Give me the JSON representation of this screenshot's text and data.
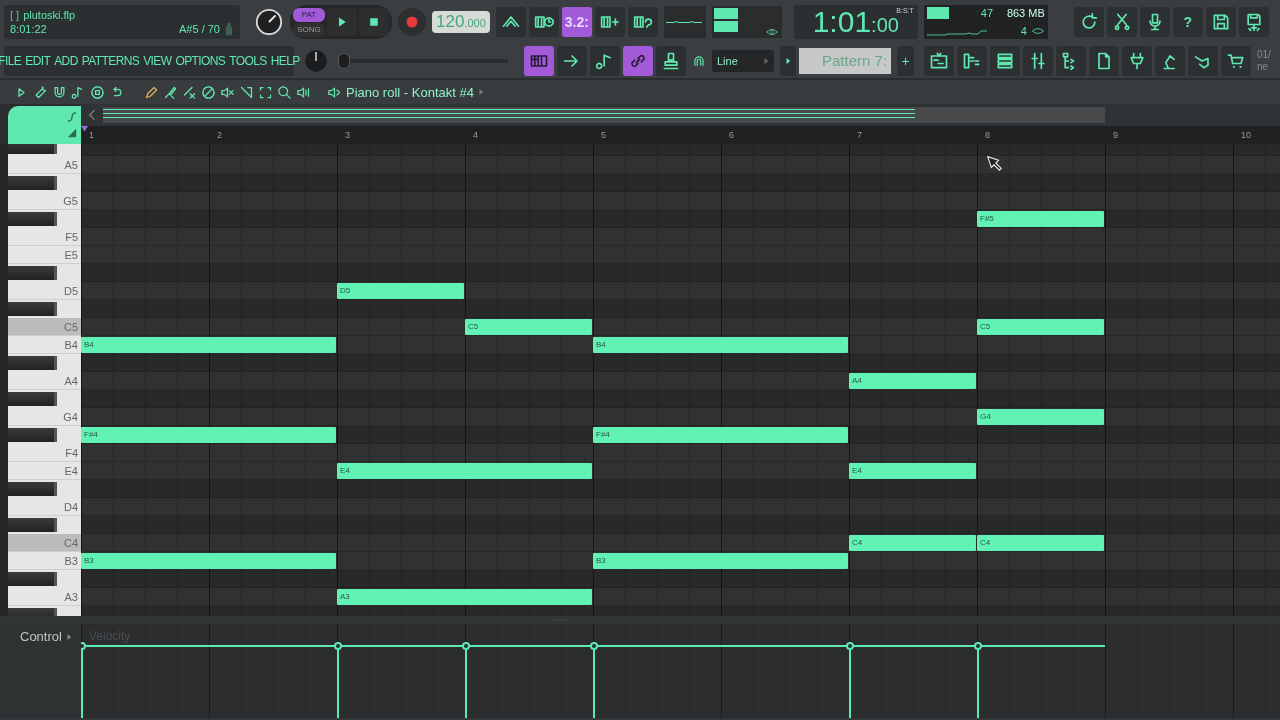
{
  "file_panel": {
    "brackets": "[ ]",
    "file_name": "plutoski.flp",
    "time": "8:01:22",
    "hint": "A#5 / 70"
  },
  "modes": [
    {
      "label": "PAT",
      "selected": true
    },
    {
      "label": "SONG",
      "selected": false
    }
  ],
  "tempo": {
    "integer": "120",
    "fraction": ".000"
  },
  "top_tools": [
    {
      "kind": "typing",
      "selected": false
    },
    {
      "kind": "metronome",
      "selected": false
    },
    {
      "kind": "step",
      "label": "3.2:",
      "selected": true
    },
    {
      "kind": "keys-plus",
      "selected": false
    },
    {
      "kind": "loop",
      "selected": false
    }
  ],
  "song_time": {
    "bars_beats": "1:01",
    "ticks": ":00",
    "unit": "B:S:T"
  },
  "cpu": {
    "level": 0.45,
    "polyphony": "47",
    "memory": "863 MB",
    "voices": "4"
  },
  "app_buttons": [
    {
      "kind": "refresh"
    },
    {
      "kind": "scissors"
    },
    {
      "kind": "microphone"
    },
    {
      "kind": "help",
      "label": "?"
    },
    {
      "kind": "save"
    },
    {
      "kind": "save-alt"
    }
  ],
  "menu": [
    "FILE",
    "EDIT",
    "ADD",
    "PATTERNS",
    "VIEW",
    "OPTIONS",
    "TOOLS",
    "HELP"
  ],
  "master_pitch": {
    "level": 0
  },
  "view_tools": [
    {
      "kind": "piano-roll",
      "selected": true
    },
    {
      "kind": "arrow",
      "selected": false
    },
    {
      "kind": "note-pen",
      "selected": false
    },
    {
      "kind": "link",
      "selected": true
    },
    {
      "kind": "stamp",
      "selected": false
    }
  ],
  "snap": {
    "value": "Line"
  },
  "pattern": {
    "value": "Pattern 7:",
    "add": "+"
  },
  "window_buttons": [
    {
      "kind": "playlist"
    },
    {
      "kind": "channel-rack"
    },
    {
      "kind": "mixer-list"
    },
    {
      "kind": "mixer"
    },
    {
      "kind": "browser"
    },
    {
      "kind": "file"
    },
    {
      "kind": "plugin"
    },
    {
      "kind": "pedal"
    },
    {
      "kind": "hand"
    },
    {
      "kind": "cart"
    }
  ],
  "edge_hint": [
    "01/",
    "ne"
  ],
  "piano_roll": {
    "title": "Piano roll - Kontakt #4",
    "tools": [
      {
        "kind": "menu-arrow"
      },
      {
        "kind": "wrench"
      },
      {
        "kind": "magnet"
      },
      {
        "kind": "note"
      },
      {
        "kind": "stop-circle"
      },
      {
        "kind": "undo"
      },
      {
        "kind": "pencil"
      },
      {
        "kind": "brush"
      },
      {
        "kind": "paint-delete"
      },
      {
        "kind": "no-sign"
      },
      {
        "kind": "mute"
      },
      {
        "kind": "slice"
      },
      {
        "kind": "select"
      },
      {
        "kind": "zoom"
      },
      {
        "kind": "speaker"
      }
    ]
  },
  "ruler": [
    "1",
    "2",
    "3",
    "4",
    "5",
    "6",
    "7",
    "8",
    "9",
    "10"
  ],
  "keys": [
    {
      "kind": "black",
      "highlighted": false
    },
    {
      "kind": "white",
      "label": "A5",
      "highlighted": false
    },
    {
      "kind": "black",
      "highlighted": false
    },
    {
      "kind": "white",
      "label": "G5",
      "highlighted": false
    },
    {
      "kind": "black",
      "highlighted": false,
      "cells": [
        {
          "kind": "empty"
        },
        {
          "kind": "empty"
        },
        {
          "kind": "empty"
        },
        {
          "kind": "empty"
        },
        {
          "kind": "empty"
        },
        {
          "kind": "empty"
        },
        {
          "kind": "empty"
        },
        {
          "kind": "start",
          "label": "F#5"
        }
      ]
    },
    {
      "kind": "white",
      "label": "F5",
      "highlighted": false
    },
    {
      "kind": "white",
      "label": "E5",
      "highlighted": false
    },
    {
      "kind": "black",
      "highlighted": false
    },
    {
      "kind": "white",
      "label": "D5",
      "highlighted": false,
      "cells": [
        {
          "kind": "empty"
        },
        {
          "kind": "empty"
        },
        {
          "kind": "start",
          "label": "D5"
        }
      ]
    },
    {
      "kind": "black",
      "highlighted": false
    },
    {
      "kind": "white",
      "label": "C5",
      "highlighted": true,
      "cells": [
        {
          "kind": "empty"
        },
        {
          "kind": "empty"
        },
        {
          "kind": "empty"
        },
        {
          "kind": "start",
          "label": "C5"
        },
        {
          "kind": "empty"
        },
        {
          "kind": "empty"
        },
        {
          "kind": "empty"
        },
        {
          "kind": "start",
          "label": "C5"
        }
      ]
    },
    {
      "kind": "white",
      "label": "B4",
      "highlighted": false,
      "cells": [
        {
          "kind": "start",
          "label": "B4"
        },
        {
          "kind": "hold"
        },
        {
          "kind": "empty"
        },
        {
          "kind": "empty"
        },
        {
          "kind": "start",
          "label": "B4"
        },
        {
          "kind": "hold"
        }
      ]
    },
    {
      "kind": "black",
      "highlighted": false
    },
    {
      "kind": "white",
      "label": "A4",
      "highlighted": false,
      "cells": [
        {
          "kind": "empty"
        },
        {
          "kind": "empty"
        },
        {
          "kind": "empty"
        },
        {
          "kind": "empty"
        },
        {
          "kind": "empty"
        },
        {
          "kind": "empty"
        },
        {
          "kind": "start",
          "label": "A4"
        }
      ]
    },
    {
      "kind": "black",
      "highlighted": false
    },
    {
      "kind": "white",
      "label": "G4",
      "highlighted": false,
      "cells": [
        {
          "kind": "empty"
        },
        {
          "kind": "empty"
        },
        {
          "kind": "empty"
        },
        {
          "kind": "empty"
        },
        {
          "kind": "empty"
        },
        {
          "kind": "empty"
        },
        {
          "kind": "empty"
        },
        {
          "kind": "start",
          "label": "G4"
        }
      ]
    },
    {
      "kind": "black",
      "highlighted": false,
      "cells": [
        {
          "kind": "start",
          "label": "F#4"
        },
        {
          "kind": "hold"
        },
        {
          "kind": "empty"
        },
        {
          "kind": "empty"
        },
        {
          "kind": "start",
          "label": "F#4"
        },
        {
          "kind": "hold"
        }
      ]
    },
    {
      "kind": "white",
      "label": "F4",
      "highlighted": false
    },
    {
      "kind": "white",
      "label": "E4",
      "highlighted": false,
      "cells": [
        {
          "kind": "empty"
        },
        {
          "kind": "empty"
        },
        {
          "kind": "start",
          "label": "E4"
        },
        {
          "kind": "hold"
        },
        {
          "kind": "empty"
        },
        {
          "kind": "empty"
        },
        {
          "kind": "start",
          "label": "E4"
        }
      ]
    },
    {
      "kind": "black",
      "highlighted": false
    },
    {
      "kind": "white",
      "label": "D4",
      "highlighted": false
    },
    {
      "kind": "black",
      "highlighted": false
    },
    {
      "kind": "white",
      "label": "C4",
      "highlighted": true,
      "cells": [
        {
          "kind": "empty"
        },
        {
          "kind": "empty"
        },
        {
          "kind": "empty"
        },
        {
          "kind": "empty"
        },
        {
          "kind": "empty"
        },
        {
          "kind": "empty"
        },
        {
          "kind": "start",
          "label": "C4"
        },
        {
          "kind": "start",
          "label": "C4"
        }
      ]
    },
    {
      "kind": "white",
      "label": "B3",
      "highlighted": false,
      "cells": [
        {
          "kind": "start",
          "label": "B3"
        },
        {
          "kind": "hold"
        },
        {
          "kind": "empty"
        },
        {
          "kind": "empty"
        },
        {
          "kind": "start",
          "label": "B3"
        },
        {
          "kind": "hold"
        }
      ]
    },
    {
      "kind": "black",
      "highlighted": false
    },
    {
      "kind": "white",
      "label": "A3",
      "highlighted": false,
      "cells": [
        {
          "kind": "empty"
        },
        {
          "kind": "empty"
        },
        {
          "kind": "start",
          "label": "A3"
        },
        {
          "kind": "hold"
        }
      ]
    },
    {
      "kind": "black",
      "highlighted": false
    }
  ],
  "control": {
    "label": "Control",
    "target": "Velocity"
  }
}
